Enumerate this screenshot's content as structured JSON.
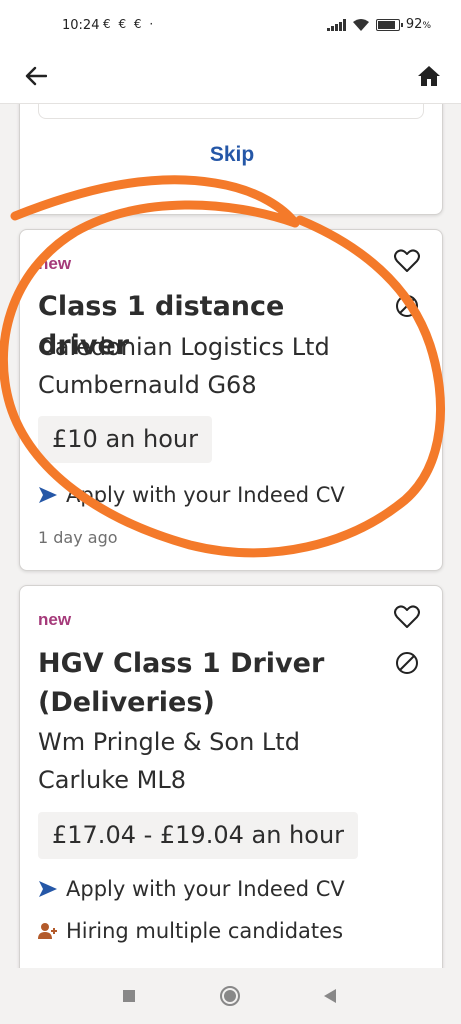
{
  "status_bar": {
    "time": "10:24",
    "notifications": "€ € €  ·",
    "battery": "92"
  },
  "app_bar": {
    "back_icon": "arrow-left-icon",
    "home_icon": "home-icon"
  },
  "top_card": {
    "skip_label": "Skip"
  },
  "jobs": [
    {
      "badge": "new",
      "title": "Class 1 distance driver",
      "company": "Caledonian Logistics Ltd",
      "location": "Cumbernauld G68",
      "salary": "£10 an hour",
      "features": [
        "Apply with your Indeed CV"
      ],
      "posted": "1 day ago"
    },
    {
      "badge": "new",
      "title_line1": "HGV Class 1 Driver",
      "title_line2": "(Deliveries)",
      "company": "Wm Pringle & Son Ltd",
      "location": "Carluke ML8",
      "salary": "£17.04 - £19.04 an hour",
      "features": [
        "Apply with your Indeed CV",
        "Hiring multiple candidates"
      ]
    }
  ],
  "colors": {
    "accent_blue": "#2557a7",
    "new_badge": "#a53a7a",
    "annotation_orange": "#f47a2a"
  },
  "nav_bar": {
    "icons": [
      "recents-square-icon",
      "home-circle-icon",
      "back-triangle-icon"
    ]
  }
}
